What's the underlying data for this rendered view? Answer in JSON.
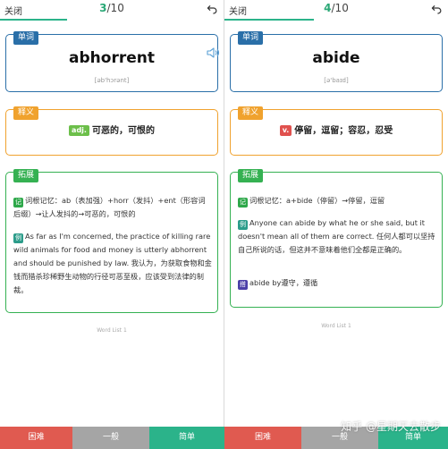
{
  "left": {
    "close_label": "关闭",
    "counter_current": "3",
    "counter_total": "/10",
    "progress_fraction": 0.3,
    "word_tag": "单词",
    "word": "abhorrent",
    "phonetic": "[əb'hɔrənt]",
    "def_tag": "释义",
    "pos": "adj.",
    "definition": "可恶的，可恨的",
    "ext_tag": "拓展",
    "mnemonic_mark": "记",
    "mnemonic": "词根记忆：ab（表加强）+horr（发抖）+ent（形容词后缀）→让人发抖的→可恶的，可恨的",
    "example_mark": "例",
    "example": "As far as I'm concerned, the practice of killing rare wild animals for food and money is utterly abhorrent and should be punished by law. 我认为，为获取食物和金钱而猎杀珍稀野生动物的行径可恶至极，应该受到法律的制裁。",
    "list_label": "Word List 1"
  },
  "right": {
    "close_label": "关闭",
    "counter_current": "4",
    "counter_total": "/10",
    "progress_fraction": 0.4,
    "word_tag": "单词",
    "word": "abide",
    "phonetic": "[ə'baɪd]",
    "def_tag": "释义",
    "pos": "v.",
    "definition": "停留，逗留；容忍，忍受",
    "ext_tag": "拓展",
    "mnemonic_mark": "记",
    "mnemonic": "词根记忆：a+bide（停留）→停留，逗留",
    "example_mark": "例",
    "example": "Anyone can abide by what he or she said, but it doesn't mean all of them are correct. 任何人都可以坚持自己所说的话，但这并不意味着他们全都是正确的。",
    "phrase_mark": "搭",
    "phrase": "abide by遵守，遵循",
    "list_label": "Word List 1"
  },
  "bottom": {
    "hard_label": "困难",
    "normal_label": "一般",
    "easy_label": "简单"
  },
  "watermark": "知乎 @星期天去散步",
  "colors": {
    "accent_green": "#2bb38a",
    "word_blue": "#2a6fa8",
    "def_orange": "#f0a22e",
    "ext_green": "#35b152",
    "hard_red": "#e05a50",
    "normal_gray": "#a5a5a5",
    "pos_adj": "#6cbf4a",
    "pos_v": "#e0514e"
  }
}
